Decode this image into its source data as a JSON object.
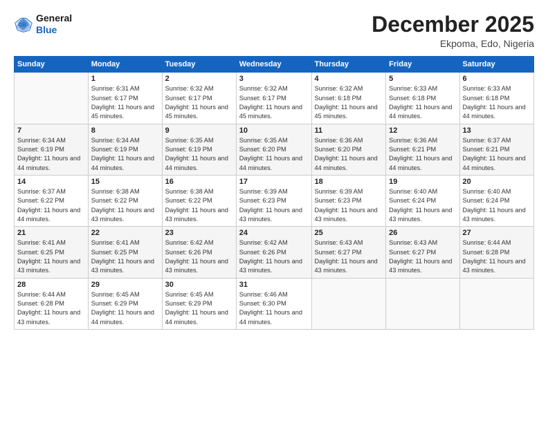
{
  "logo": {
    "line1": "General",
    "line2": "Blue"
  },
  "title": "December 2025",
  "location": "Ekpoma, Edo, Nigeria",
  "weekdays": [
    "Sunday",
    "Monday",
    "Tuesday",
    "Wednesday",
    "Thursday",
    "Friday",
    "Saturday"
  ],
  "weeks": [
    [
      {
        "day": "",
        "sunrise": "",
        "sunset": "",
        "daylight": ""
      },
      {
        "day": "1",
        "sunrise": "Sunrise: 6:31 AM",
        "sunset": "Sunset: 6:17 PM",
        "daylight": "Daylight: 11 hours and 45 minutes."
      },
      {
        "day": "2",
        "sunrise": "Sunrise: 6:32 AM",
        "sunset": "Sunset: 6:17 PM",
        "daylight": "Daylight: 11 hours and 45 minutes."
      },
      {
        "day": "3",
        "sunrise": "Sunrise: 6:32 AM",
        "sunset": "Sunset: 6:17 PM",
        "daylight": "Daylight: 11 hours and 45 minutes."
      },
      {
        "day": "4",
        "sunrise": "Sunrise: 6:32 AM",
        "sunset": "Sunset: 6:18 PM",
        "daylight": "Daylight: 11 hours and 45 minutes."
      },
      {
        "day": "5",
        "sunrise": "Sunrise: 6:33 AM",
        "sunset": "Sunset: 6:18 PM",
        "daylight": "Daylight: 11 hours and 44 minutes."
      },
      {
        "day": "6",
        "sunrise": "Sunrise: 6:33 AM",
        "sunset": "Sunset: 6:18 PM",
        "daylight": "Daylight: 11 hours and 44 minutes."
      }
    ],
    [
      {
        "day": "7",
        "sunrise": "Sunrise: 6:34 AM",
        "sunset": "Sunset: 6:19 PM",
        "daylight": "Daylight: 11 hours and 44 minutes."
      },
      {
        "day": "8",
        "sunrise": "Sunrise: 6:34 AM",
        "sunset": "Sunset: 6:19 PM",
        "daylight": "Daylight: 11 hours and 44 minutes."
      },
      {
        "day": "9",
        "sunrise": "Sunrise: 6:35 AM",
        "sunset": "Sunset: 6:19 PM",
        "daylight": "Daylight: 11 hours and 44 minutes."
      },
      {
        "day": "10",
        "sunrise": "Sunrise: 6:35 AM",
        "sunset": "Sunset: 6:20 PM",
        "daylight": "Daylight: 11 hours and 44 minutes."
      },
      {
        "day": "11",
        "sunrise": "Sunrise: 6:36 AM",
        "sunset": "Sunset: 6:20 PM",
        "daylight": "Daylight: 11 hours and 44 minutes."
      },
      {
        "day": "12",
        "sunrise": "Sunrise: 6:36 AM",
        "sunset": "Sunset: 6:21 PM",
        "daylight": "Daylight: 11 hours and 44 minutes."
      },
      {
        "day": "13",
        "sunrise": "Sunrise: 6:37 AM",
        "sunset": "Sunset: 6:21 PM",
        "daylight": "Daylight: 11 hours and 44 minutes."
      }
    ],
    [
      {
        "day": "14",
        "sunrise": "Sunrise: 6:37 AM",
        "sunset": "Sunset: 6:22 PM",
        "daylight": "Daylight: 11 hours and 44 minutes."
      },
      {
        "day": "15",
        "sunrise": "Sunrise: 6:38 AM",
        "sunset": "Sunset: 6:22 PM",
        "daylight": "Daylight: 11 hours and 43 minutes."
      },
      {
        "day": "16",
        "sunrise": "Sunrise: 6:38 AM",
        "sunset": "Sunset: 6:22 PM",
        "daylight": "Daylight: 11 hours and 43 minutes."
      },
      {
        "day": "17",
        "sunrise": "Sunrise: 6:39 AM",
        "sunset": "Sunset: 6:23 PM",
        "daylight": "Daylight: 11 hours and 43 minutes."
      },
      {
        "day": "18",
        "sunrise": "Sunrise: 6:39 AM",
        "sunset": "Sunset: 6:23 PM",
        "daylight": "Daylight: 11 hours and 43 minutes."
      },
      {
        "day": "19",
        "sunrise": "Sunrise: 6:40 AM",
        "sunset": "Sunset: 6:24 PM",
        "daylight": "Daylight: 11 hours and 43 minutes."
      },
      {
        "day": "20",
        "sunrise": "Sunrise: 6:40 AM",
        "sunset": "Sunset: 6:24 PM",
        "daylight": "Daylight: 11 hours and 43 minutes."
      }
    ],
    [
      {
        "day": "21",
        "sunrise": "Sunrise: 6:41 AM",
        "sunset": "Sunset: 6:25 PM",
        "daylight": "Daylight: 11 hours and 43 minutes."
      },
      {
        "day": "22",
        "sunrise": "Sunrise: 6:41 AM",
        "sunset": "Sunset: 6:25 PM",
        "daylight": "Daylight: 11 hours and 43 minutes."
      },
      {
        "day": "23",
        "sunrise": "Sunrise: 6:42 AM",
        "sunset": "Sunset: 6:26 PM",
        "daylight": "Daylight: 11 hours and 43 minutes."
      },
      {
        "day": "24",
        "sunrise": "Sunrise: 6:42 AM",
        "sunset": "Sunset: 6:26 PM",
        "daylight": "Daylight: 11 hours and 43 minutes."
      },
      {
        "day": "25",
        "sunrise": "Sunrise: 6:43 AM",
        "sunset": "Sunset: 6:27 PM",
        "daylight": "Daylight: 11 hours and 43 minutes."
      },
      {
        "day": "26",
        "sunrise": "Sunrise: 6:43 AM",
        "sunset": "Sunset: 6:27 PM",
        "daylight": "Daylight: 11 hours and 43 minutes."
      },
      {
        "day": "27",
        "sunrise": "Sunrise: 6:44 AM",
        "sunset": "Sunset: 6:28 PM",
        "daylight": "Daylight: 11 hours and 43 minutes."
      }
    ],
    [
      {
        "day": "28",
        "sunrise": "Sunrise: 6:44 AM",
        "sunset": "Sunset: 6:28 PM",
        "daylight": "Daylight: 11 hours and 43 minutes."
      },
      {
        "day": "29",
        "sunrise": "Sunrise: 6:45 AM",
        "sunset": "Sunset: 6:29 PM",
        "daylight": "Daylight: 11 hours and 44 minutes."
      },
      {
        "day": "30",
        "sunrise": "Sunrise: 6:45 AM",
        "sunset": "Sunset: 6:29 PM",
        "daylight": "Daylight: 11 hours and 44 minutes."
      },
      {
        "day": "31",
        "sunrise": "Sunrise: 6:46 AM",
        "sunset": "Sunset: 6:30 PM",
        "daylight": "Daylight: 11 hours and 44 minutes."
      },
      {
        "day": "",
        "sunrise": "",
        "sunset": "",
        "daylight": ""
      },
      {
        "day": "",
        "sunrise": "",
        "sunset": "",
        "daylight": ""
      },
      {
        "day": "",
        "sunrise": "",
        "sunset": "",
        "daylight": ""
      }
    ]
  ]
}
